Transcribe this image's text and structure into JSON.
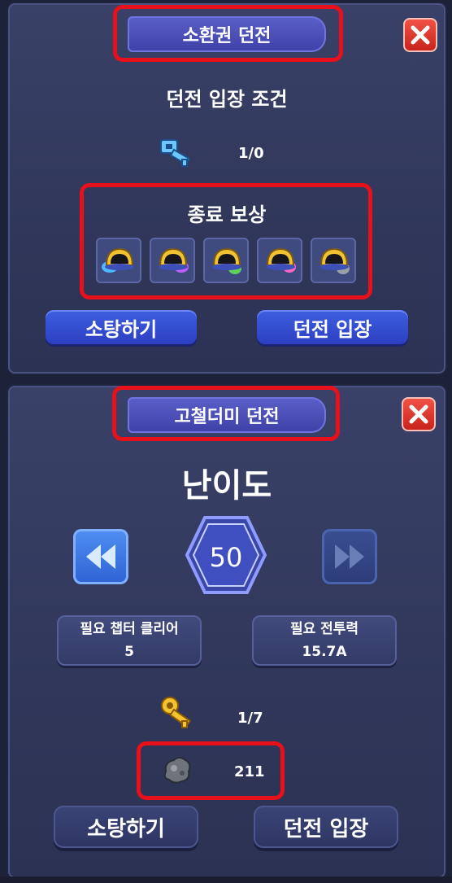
{
  "summon_dungeon": {
    "title": "소환권 던전",
    "entry_condition_label": "던전 입장 조건",
    "key_icon": "blue-key-icon",
    "key_count": "1/0",
    "reward_label": "종료 보상",
    "rewards": [
      {
        "icon": "helmet-gem-icon",
        "accent": "#4fb8ff"
      },
      {
        "icon": "helmet-gem-icon",
        "accent": "#c060ff"
      },
      {
        "icon": "helmet-gem-icon",
        "accent": "#5ed05e"
      },
      {
        "icon": "helmet-gem-icon",
        "accent": "#ff66c4"
      },
      {
        "icon": "helmet-gem-icon",
        "accent": "#9aa0a8"
      }
    ],
    "sweep_label": "소탕하기",
    "enter_label": "던전 입장"
  },
  "iron_dungeon": {
    "title": "고철더미 던전",
    "difficulty_label": "난이도",
    "difficulty_value": "50",
    "req_chapter_label": "필요 챕터 클리어",
    "req_chapter_value": "5",
    "req_power_label": "필요 전투력",
    "req_power_value": "15.7A",
    "key_icon": "gold-key-icon",
    "key_count": "1/7",
    "scrap_icon": "scrap-ore-icon",
    "scrap_count": "211",
    "sweep_label": "소탕하기",
    "enter_label": "던전 입장"
  },
  "colors": {
    "panel": "#343b60",
    "highlight": "#e8101a",
    "close_button": "#e0392e",
    "primary_button": "#3550d8"
  }
}
